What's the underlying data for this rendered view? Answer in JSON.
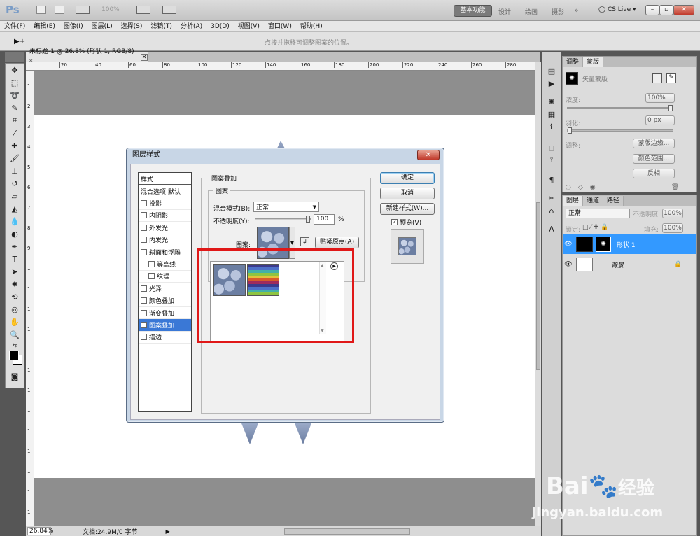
{
  "app": {
    "logo": "Ps",
    "zoom_combo": "100%",
    "workspaces": [
      "基本功能",
      "设计",
      "绘画",
      "摄影"
    ],
    "more": "»",
    "cslive": "CS Live",
    "window_controls": [
      "–",
      "▫",
      "✕"
    ]
  },
  "menu": [
    "文件(F)",
    "编辑(E)",
    "图像(I)",
    "图层(L)",
    "选择(S)",
    "滤镜(T)",
    "分析(A)",
    "3D(D)",
    "视图(V)",
    "窗口(W)",
    "帮助(H)"
  ],
  "options": {
    "tool_arrow": "▶+",
    "hint": "点按并拖移可调整图案的位置。"
  },
  "document": {
    "tab_title": "未标题-1 @ 26.8% (形状 1, RGB/8) *",
    "ruler_h": [
      "20",
      "40",
      "60",
      "80",
      "100",
      "120",
      "140",
      "160",
      "180",
      "200",
      "220",
      "240",
      "260",
      "280"
    ],
    "ruler_v": [
      "1",
      "2",
      "3",
      "4",
      "5",
      "6",
      "7",
      "8",
      "9",
      "1",
      "1",
      "1",
      "1",
      "1",
      "1",
      "1",
      "1",
      "1",
      "1",
      "1",
      "1",
      "1"
    ]
  },
  "status": {
    "zoom": "26.84%",
    "doc_info": "文档:24.9M/0 字节"
  },
  "adjust_panel": {
    "tabs": [
      "调整",
      "蒙版"
    ],
    "mask_label": "矢量蒙版",
    "density_label": "浓度:",
    "density_value": "100%",
    "feather_label": "羽化:",
    "feather_value": "0 px",
    "adjust_label": "调整:",
    "btn_edge": "蒙版边缘...",
    "btn_color": "颜色范围...",
    "btn_invert": "反相",
    "density_level": 1.0,
    "feather_level": 0.0
  },
  "layers_panel": {
    "tabs": [
      "图层",
      "通道",
      "路径"
    ],
    "blend_mode": "正常",
    "opacity_label": "不透明度:",
    "opacity_value": "100%",
    "lock_label": "锁定:",
    "fill_label": "填充:",
    "fill_value": "100%",
    "layers": [
      {
        "name": "形状 1",
        "selected": true
      },
      {
        "name": "背景",
        "selected": false
      }
    ]
  },
  "dialog": {
    "title": "图层样式",
    "close": "✕",
    "styles_header": "样式",
    "blend_default": "混合选项:默认",
    "style_items": [
      {
        "label": "投影",
        "checked": false,
        "indent": false
      },
      {
        "label": "内阴影",
        "checked": false,
        "indent": false
      },
      {
        "label": "外发光",
        "checked": false,
        "indent": false
      },
      {
        "label": "内发光",
        "checked": false,
        "indent": false
      },
      {
        "label": "斜面和浮雕",
        "checked": false,
        "indent": false
      },
      {
        "label": "等高线",
        "checked": false,
        "indent": true
      },
      {
        "label": "纹理",
        "checked": false,
        "indent": true
      },
      {
        "label": "光泽",
        "checked": false,
        "indent": false
      },
      {
        "label": "颜色叠加",
        "checked": false,
        "indent": false
      },
      {
        "label": "渐变叠加",
        "checked": false,
        "indent": false
      },
      {
        "label": "图案叠加",
        "checked": true,
        "indent": false,
        "selected": true
      },
      {
        "label": "描边",
        "checked": false,
        "indent": false
      }
    ],
    "section_title": "图案叠加",
    "group_title": "图案",
    "blend_mode_label": "混合模式(B):",
    "blend_mode_value": "正常",
    "opacity_label": "不透明度(Y):",
    "opacity_value": "100",
    "opacity_unit": "%",
    "opacity_level": 1.0,
    "pattern_label": "图案:",
    "snap_button": "贴紧原点(A)",
    "ok": "确定",
    "cancel": "取消",
    "new_style": "新建样式(W)...",
    "preview_label": "预览(V)",
    "preview_checked": true
  },
  "watermark": {
    "brand": "Bai",
    "brand_cn": "经验",
    "url": "jingyan.baidu.com"
  },
  "colors": {
    "highlight": "#e01818",
    "selection": "#3a78d6",
    "layer_selected": "#3399ff"
  }
}
